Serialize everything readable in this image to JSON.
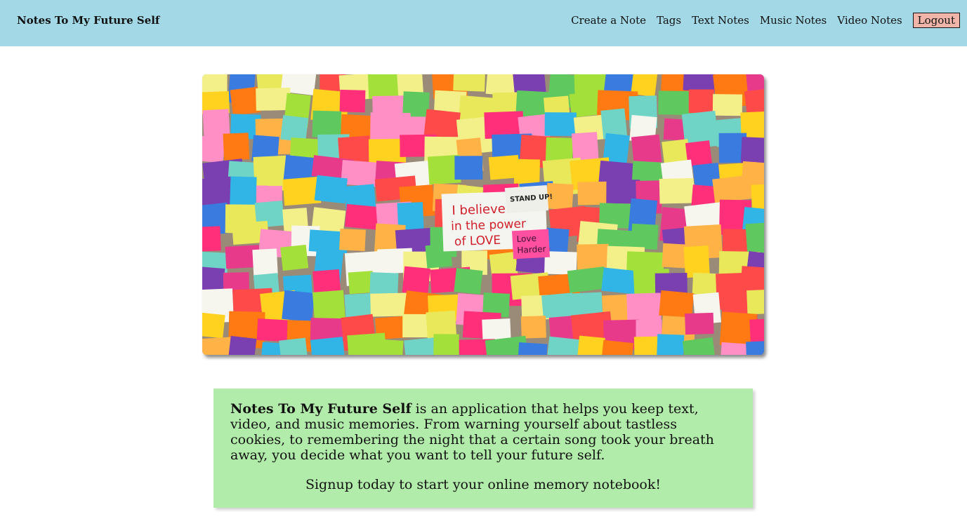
{
  "nav": {
    "brand": "Notes To My Future Self",
    "links": [
      "Create a Note",
      "Tags",
      "Text Notes",
      "Music Notes",
      "Video Notes"
    ],
    "logout": "Logout",
    "colors": {
      "bar": "#a3d8e7",
      "logout_bg": "#f0b4a8"
    }
  },
  "hero": {
    "icon": "sticky-notes-wall-photo",
    "center_note_lines": [
      "I believe",
      "in the power",
      "of LOVE"
    ],
    "stand_note": "STAND UP!",
    "love_harder_lines": [
      "Love",
      "Harder"
    ]
  },
  "intro": {
    "app_name": "Notes To My Future Self",
    "description": " is an application that helps you keep text, video, and music memories. From warning yourself about tastless cookies, to remembering the night that a certain song took your breath away, you decide what you want to tell your future self.",
    "tagline": "Signup today to start your online memory notebook!",
    "box_color": "#b2ecaa"
  }
}
